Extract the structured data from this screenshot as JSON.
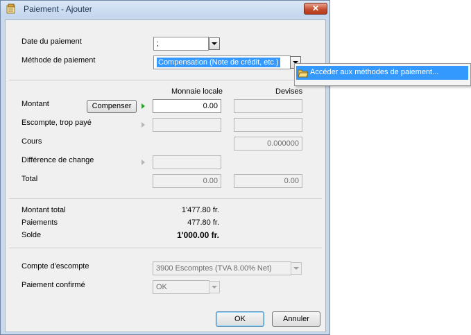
{
  "window": {
    "title": "Paiement - Ajouter",
    "close_glyph": "✕"
  },
  "form": {
    "date_label": "Date du paiement",
    "date_value": ";",
    "method_label": "Méthode de paiement",
    "method_value": "Compensation (Note de crédit, etc.)"
  },
  "popup": {
    "item_label": "Accéder aux méthodes de paiement..."
  },
  "amounts": {
    "col_local": "Monnaie locale",
    "col_currency": "Devises",
    "montant_label": "Montant",
    "compenser_label": "Compenser",
    "montant_local": "0.00",
    "montant_currency": "",
    "escompte_label": "Escompte, trop payé",
    "escompte_local": "",
    "escompte_currency": "",
    "cours_label": "Cours",
    "cours_value": "0.000000",
    "diff_label": "Différence de change",
    "diff_local": "",
    "total_label": "Total",
    "total_local": "0.00",
    "total_currency": "0.00"
  },
  "summary": {
    "montant_total_label": "Montant total",
    "montant_total_value": "1'477.80 fr.",
    "paiements_label": "Paiements",
    "paiements_value": "477.80 fr.",
    "solde_label": "Solde",
    "solde_value": "1'000.00 fr."
  },
  "options": {
    "compte_label": "Compte d'escompte",
    "compte_value": "3900 Escomptes (TVA 8.00% Net)",
    "confirme_label": "Paiement confirmé",
    "confirme_value": "OK"
  },
  "buttons": {
    "ok_label": "OK",
    "cancel_label": "Annuler"
  },
  "colors": {
    "titlebar": "#c9d9ec",
    "selection": "#3399ff",
    "close": "#c44a2c",
    "active_arrow": "#2ca02c"
  }
}
